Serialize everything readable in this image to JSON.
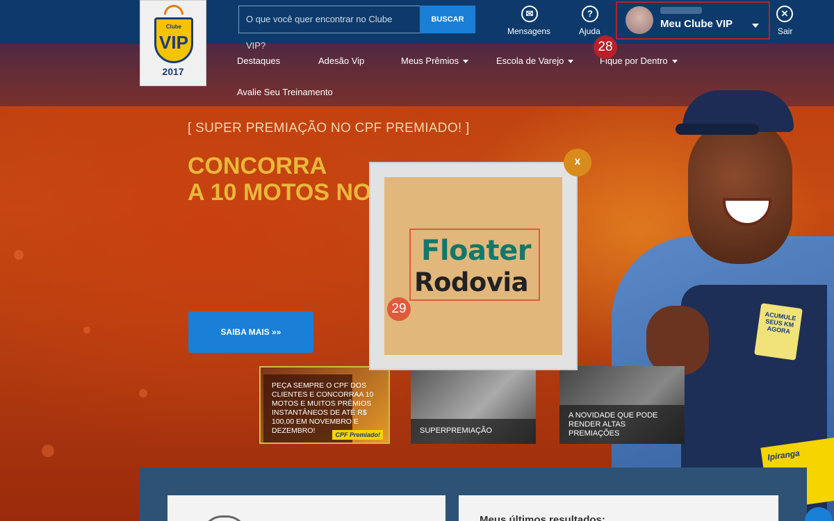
{
  "header": {
    "logo": {
      "line1": "Clube",
      "line2": "VIP",
      "year": "2017"
    },
    "search": {
      "placeholder": "O que você quer encontrar no Clube VIP?",
      "button": "BUSCAR"
    },
    "icons": [
      {
        "name": "Mensagens",
        "glyph": "✉"
      },
      {
        "name": "Ajuda",
        "glyph": "?"
      },
      {
        "name": "Sair",
        "glyph": "✕"
      }
    ],
    "account": {
      "label": "Meu Clube VIP"
    },
    "badge_28": "28"
  },
  "nav": {
    "items": [
      {
        "label": "Destaques",
        "dropdown": false
      },
      {
        "label": "Adesão Vip",
        "dropdown": false
      },
      {
        "label": "Meus Prêmios",
        "dropdown": true
      },
      {
        "label": "Escola de Varejo",
        "dropdown": true
      },
      {
        "label": "Fique por Dentro",
        "dropdown": true
      },
      {
        "label": "Avalie Seu Treinamento",
        "dropdown": false
      }
    ]
  },
  "hero": {
    "kicker": "[ SUPER PREMIAÇÃO NO CPF PREMIADO! ]",
    "headline_line1": "CONCORRA",
    "headline_line2": "A 10 MOTOS NO",
    "cta": "SAIBA MAIS »»",
    "badge_text": "ACUMULE SEUS KM AGORA",
    "card_text": "Ipiranga"
  },
  "thumbs": [
    {
      "text": "PEÇA SEMPRE O CPF DOS CLIENTES E CONCORRAA 10 MOTOS E MUITOS PRÊMIOS INSTANTÂNEOS DE ATÉ R$ 100,00 EM NOVEMBRO E DEZEMBRO!",
      "tag": "CPF Premiado!"
    },
    {
      "text": "SUPERPREMIAÇÃO"
    },
    {
      "text": "A NOVIDADE QUE PODE RENDER ALTAS PREMIAÇÕES"
    }
  ],
  "bottom": {
    "right_title": "Meus últimos resultados:"
  },
  "modal": {
    "line1": "Floater",
    "line2": "Rodovia",
    "close": "x",
    "badge_29": "29"
  },
  "colors": {
    "header_bg": "#0d3a6b",
    "accent_blue": "#1a7fd6",
    "headline_gold": "#e8b93a",
    "badge_red": "#b8202a",
    "modal_close": "#d98c1c",
    "floater_green": "#11786a"
  }
}
